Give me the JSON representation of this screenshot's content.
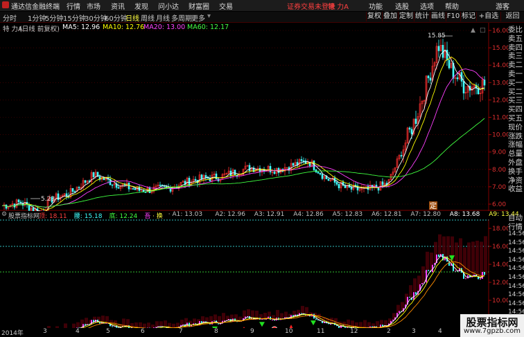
{
  "titlebar": {
    "app_name": "通达信金融终端",
    "menu": [
      "行情",
      "市场",
      "资讯",
      "发现",
      "问小达",
      "财富圈",
      "交易"
    ],
    "login_status": "证券交易未登录",
    "stock": "特 力A",
    "right_menu": [
      "功能",
      "选股",
      "选项",
      "帮助",
      "游客"
    ]
  },
  "periodbar": {
    "periods": [
      "分时",
      "1分钟",
      "5分钟",
      "15分钟",
      "30分钟",
      "60分钟",
      "日线",
      "周线",
      "月线",
      "多周期",
      "更多"
    ],
    "active": "日线",
    "right_tabs": [
      "复权",
      "叠加",
      "定制",
      "统计",
      "画线",
      "F10",
      "标记",
      "+自选",
      "返回"
    ]
  },
  "infoline": {
    "stock_label": "特 力A",
    "period_label": "(日线 前复权)",
    "ma": [
      {
        "label": "MA5: 12.96",
        "color": "#ffffff"
      },
      {
        "label": "MA10: 12.76",
        "color": "#ffff00"
      },
      {
        "label": "MA20: 13.00",
        "color": "#ff40ff"
      },
      {
        "label": "MA60: 12.17",
        "color": "#40ff40"
      }
    ]
  },
  "main_chart": {
    "price_axis": [
      "16.00",
      "15.00",
      "14.00",
      "13.00",
      "12.00",
      "11.00",
      "10.00",
      "9.00",
      "8.00",
      "7.00",
      "6.00"
    ],
    "high_marker": "15.85",
    "low_marker": "5.23",
    "badge": "定"
  },
  "indicator": {
    "name": "股票指标网",
    "params": [
      {
        "label": "顶: 18.11",
        "color": "#ff4040"
      },
      {
        "label": "腰: 15.18",
        "color": "#40ffff"
      },
      {
        "label": "底: 12.24",
        "color": "#40ff40"
      },
      {
        "label": "吾",
        "color": "#ff40ff"
      },
      {
        "label": "· 换",
        "color": "#ffff40"
      },
      {
        "label": "· A1: 13.03",
        "color": "#c0c0c0"
      },
      {
        "label": "A2: 12.96",
        "color": "#c0c0c0"
      },
      {
        "label": "A3: 12.91",
        "color": "#c0c0c0"
      },
      {
        "label": "A4: 12.86",
        "color": "#c0c0c0"
      },
      {
        "label": "A5: 12.83",
        "color": "#c0c0c0"
      },
      {
        "label": "A6: 12.81",
        "color": "#c0c0c0"
      },
      {
        "label": "A7: 12.80",
        "color": "#c0c0c0"
      },
      {
        "label": "A8: 13.68",
        "color": "#ffffff"
      },
      {
        "label": "A9: 13.44",
        "color": "#ffff40"
      },
      {
        "label": "低",
        "color": "#ff4040"
      },
      {
        "label": "· 高",
        "color": "#40ff40"
      }
    ],
    "price_axis": [
      "18.00",
      "16.00",
      "14.00",
      "12.00",
      "10.00",
      "8.00"
    ]
  },
  "right_panel": {
    "items": [
      "委比",
      "卖五",
      "卖四",
      "卖三",
      "卖二",
      "卖一",
      "买一",
      "买二",
      "买三",
      "买四",
      "买五",
      "现价",
      "涨跌",
      "涨幅",
      "总量",
      "外盘",
      "换手",
      "净资",
      "收益",
      "自动",
      "行情"
    ],
    "times": [
      "14:56",
      "14:56",
      "14:56",
      "14:56",
      "14:56",
      "14:56",
      "14:56",
      "14:56",
      "14:56",
      "14:56"
    ]
  },
  "xaxis": {
    "labels": [
      "2014年",
      "3",
      "4",
      "5",
      "6",
      "7",
      "8",
      "9",
      "10",
      "11",
      "12",
      "2",
      "3",
      "4"
    ]
  },
  "watermark": {
    "title": "股票指标网",
    "url": "www.7gpzb.com"
  },
  "colors": {
    "up": "#ff3030",
    "down": "#40ffff",
    "ma5": "#ffffff",
    "ma10": "#ffff00",
    "ma20": "#ff40ff",
    "ma60": "#40ff40",
    "grid": "#600000"
  }
}
